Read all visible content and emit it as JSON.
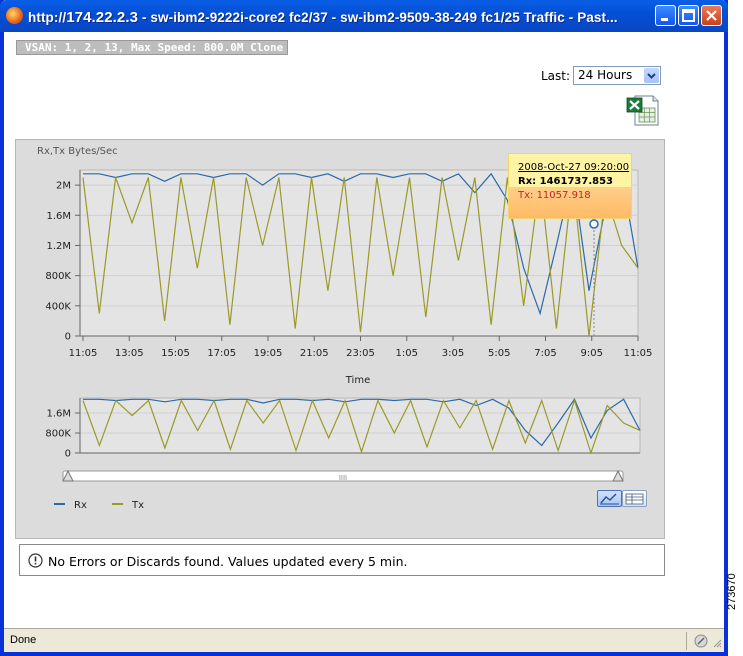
{
  "window": {
    "title_prefix": "http://",
    "title_ip": "174.22.2.3",
    "title_rest": " - sw-ibm2-9222i-core2 fc2/37 - sw-ibm2-9509-38-249 fc1/25 Traffic - Past..."
  },
  "vsan_label": "VSAN: 1, 2, 13, Max Speed: 800.0M Clone",
  "controls": {
    "last_label": "Last:",
    "last_value": "24 Hours",
    "export_icon": "excel-export-icon"
  },
  "chart_data": [
    {
      "type": "line",
      "ylabel": "Rx,Tx Bytes/Sec",
      "xlabel": "Time",
      "x_ticks": [
        "11:05",
        "13:05",
        "15:05",
        "17:05",
        "19:05",
        "21:05",
        "23:05",
        "1:05",
        "3:05",
        "5:05",
        "7:05",
        "9:05",
        "11:05"
      ],
      "y_ticks": [
        "0",
        "400K",
        "800K",
        "1.2M",
        "1.6M",
        "2M"
      ],
      "ylim": [
        0,
        2200000
      ],
      "grid": true,
      "series": [
        {
          "name": "Rx",
          "color": "#2a6aa8",
          "values": [
            2150000,
            2150000,
            2100000,
            2150000,
            2150000,
            2050000,
            2150000,
            2150000,
            2100000,
            2150000,
            2150000,
            2000000,
            2150000,
            2150000,
            2100000,
            2150000,
            2050000,
            2150000,
            2150000,
            2100000,
            2150000,
            2150000,
            2050000,
            2150000,
            1900000,
            2150000,
            1800000,
            900000,
            300000,
            1200000,
            2150000,
            600000,
            1700000,
            2150000,
            900000
          ]
        },
        {
          "name": "Tx",
          "color": "#9a9a2a",
          "values": [
            2100000,
            300000,
            2100000,
            1500000,
            2100000,
            200000,
            2100000,
            900000,
            2100000,
            150000,
            2100000,
            1200000,
            2100000,
            100000,
            2100000,
            600000,
            2100000,
            50000,
            2100000,
            800000,
            2100000,
            250000,
            2100000,
            1000000,
            2100000,
            150000,
            2100000,
            400000,
            2100000,
            100000,
            2100000,
            0,
            1900000,
            1200000,
            900000
          ]
        }
      ],
      "tooltip": {
        "date": "2008-Oct-27 09:20:00",
        "rx": "Rx: 1461737.853",
        "tx": "Tx: 11057.918"
      }
    },
    {
      "type": "line",
      "ylabel": "",
      "xlabel": "",
      "y_ticks": [
        "0",
        "800K",
        "1.6M"
      ],
      "ylim": [
        0,
        2200000
      ],
      "grid": true,
      "series": [
        {
          "name": "Rx",
          "color": "#2a6aa8",
          "values": [
            2150000,
            2150000,
            2100000,
            2150000,
            2150000,
            2050000,
            2150000,
            2150000,
            2100000,
            2150000,
            2150000,
            2000000,
            2150000,
            2150000,
            2100000,
            2150000,
            2050000,
            2150000,
            2150000,
            2100000,
            2150000,
            2150000,
            2050000,
            2150000,
            1900000,
            2150000,
            1800000,
            900000,
            300000,
            1200000,
            2150000,
            600000,
            1700000,
            2150000,
            900000
          ]
        },
        {
          "name": "Tx",
          "color": "#9a9a2a",
          "values": [
            2100000,
            300000,
            2100000,
            1500000,
            2100000,
            200000,
            2100000,
            900000,
            2100000,
            150000,
            2100000,
            1200000,
            2100000,
            100000,
            2100000,
            600000,
            2100000,
            50000,
            2100000,
            800000,
            2100000,
            250000,
            2100000,
            1000000,
            2100000,
            150000,
            2100000,
            400000,
            2100000,
            100000,
            2100000,
            0,
            1900000,
            1200000,
            900000
          ]
        }
      ]
    }
  ],
  "legend": {
    "rx": "Rx",
    "tx": "Tx"
  },
  "view_buttons": {
    "chart": "chart-view-icon",
    "table": "table-view-icon"
  },
  "scrollbar_grip": "IIII",
  "message": "No Errors or Discards found. Values updated every 5 min.",
  "statusbar": {
    "text": "Done"
  },
  "figure_number": "273670"
}
